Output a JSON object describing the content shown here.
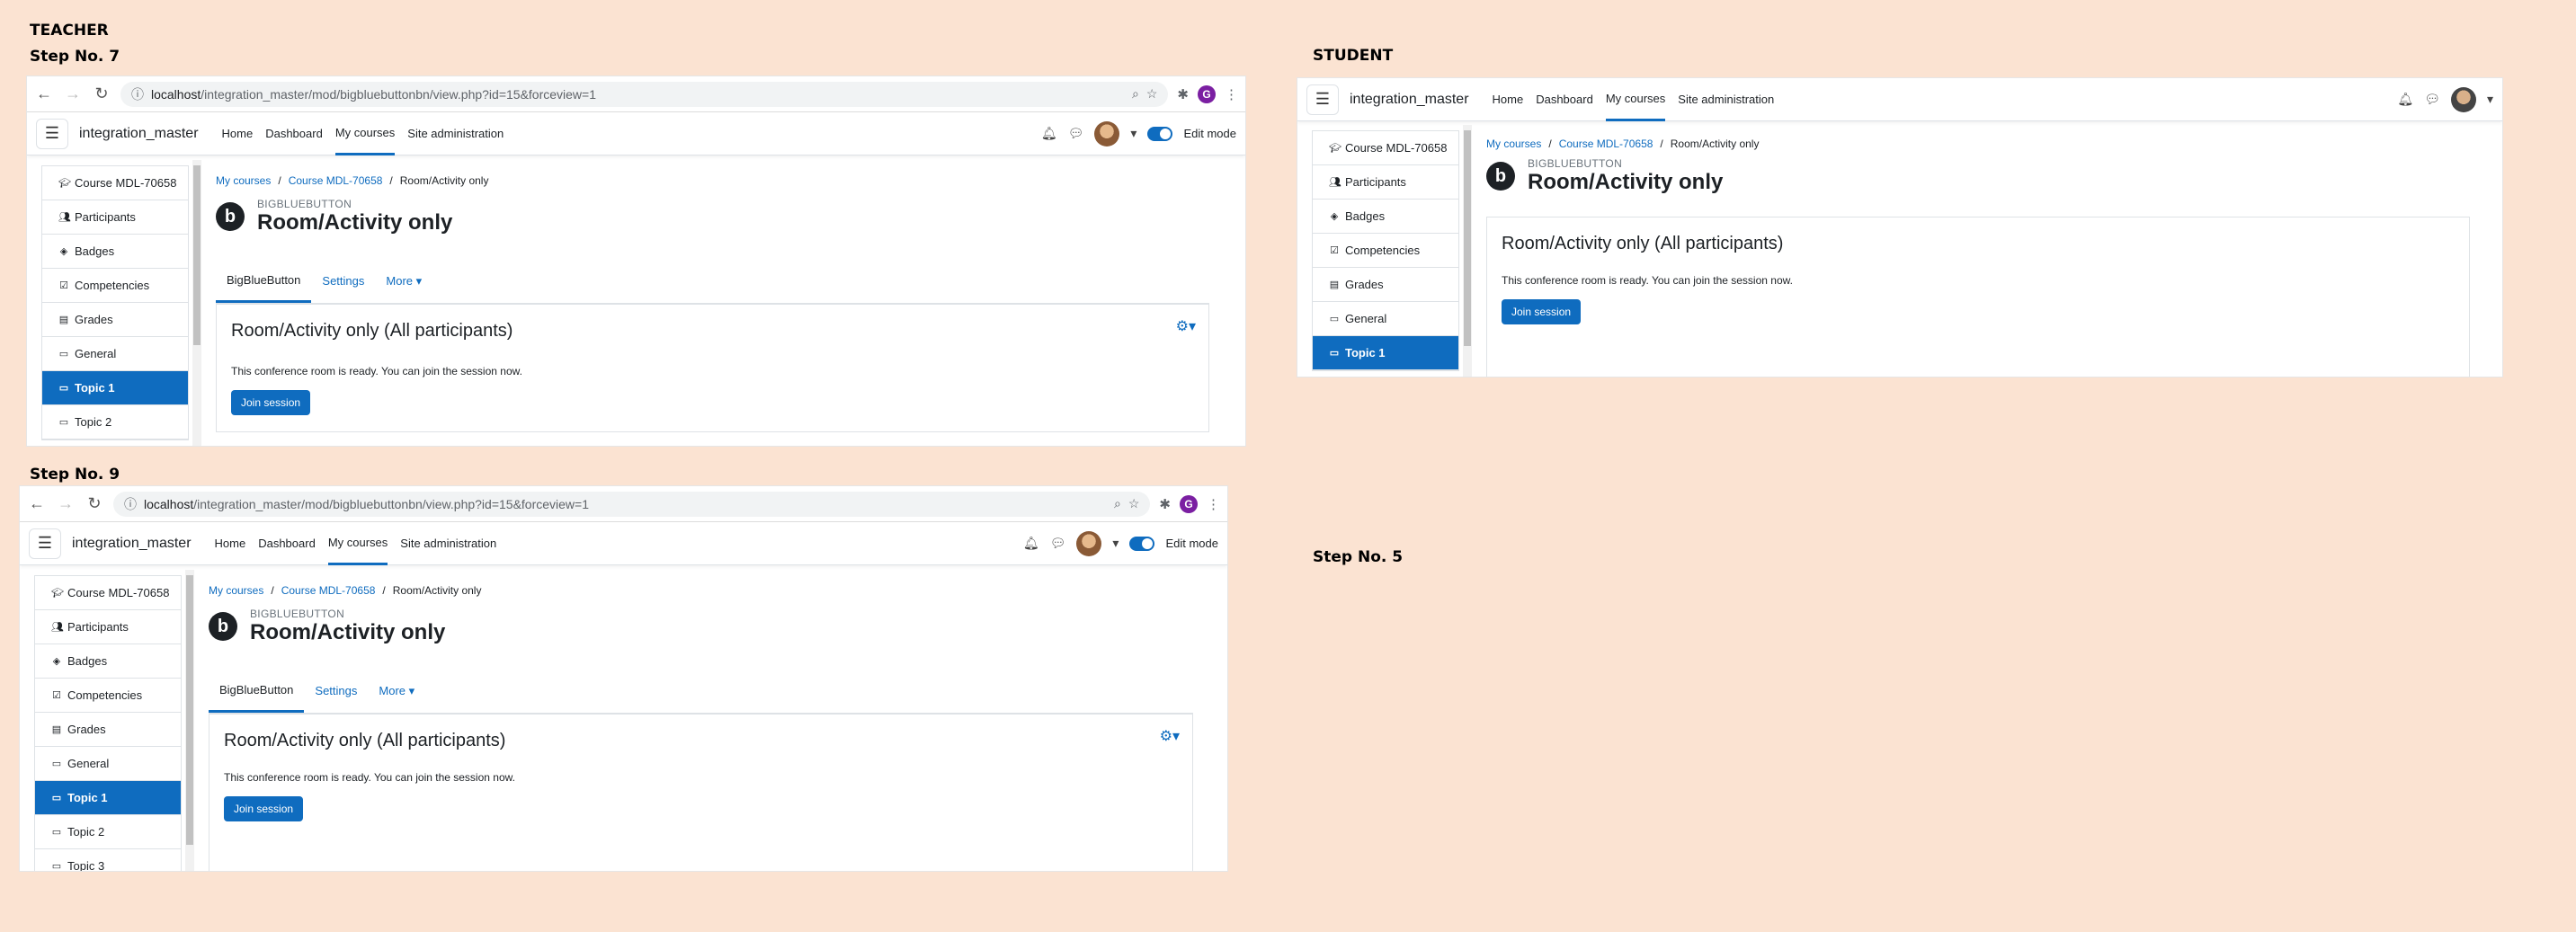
{
  "labels": {
    "teacher": "TEACHER",
    "student": "STUDENT",
    "step7": "Step No.  7",
    "step9": "Step No. 9",
    "step5": "Step No. 5"
  },
  "browser": {
    "host": "localhost",
    "path": "/integration_master/mod/bigbluebuttonbn/view.php?id=15&forceview=1",
    "profile_initial": "G"
  },
  "navbar": {
    "site_name": "integration_master",
    "links": [
      "Home",
      "Dashboard",
      "My courses",
      "Site administration"
    ],
    "edit_mode": "Edit mode"
  },
  "course_index": [
    "Course MDL-70658",
    "Participants",
    "Badges",
    "Competencies",
    "Grades",
    "General",
    "Topic 1",
    "Topic 2",
    "Topic 3"
  ],
  "breadcrumb": [
    "My courses",
    "Course MDL-70658",
    "Room/Activity only"
  ],
  "activity": {
    "kind": "BIGBLUEBUTTON",
    "title": "Room/Activity only",
    "tabs": [
      "BigBlueButton",
      "Settings",
      "More"
    ],
    "room_heading": "Room/Activity only (All participants)",
    "status_text": "This conference room is ready. You can join the session now.",
    "join_label": "Join session"
  },
  "colors": {
    "background": "#fbe3d2",
    "accent": "#0f6cbf"
  }
}
